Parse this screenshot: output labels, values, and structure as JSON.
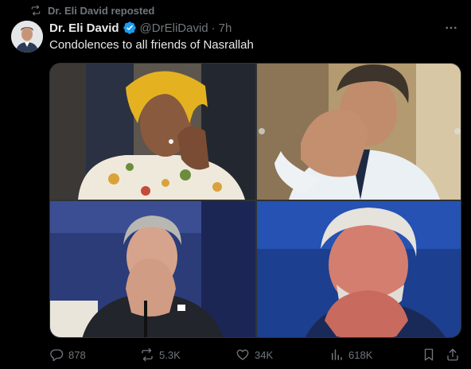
{
  "repost": {
    "label": "Dr. Eli David reposted",
    "icon": "repost-icon"
  },
  "author": {
    "name": "Dr. Eli David",
    "handle": "@DrEliDavid",
    "time_sep": "·",
    "time": "7h",
    "verified_color": "#1d9bf0"
  },
  "tweet": {
    "text": "Condolences to all friends of Nasrallah"
  },
  "media": {
    "count": 4
  },
  "actions": {
    "replies": "878",
    "reposts": "5.3K",
    "likes": "34K",
    "views": "618K"
  },
  "colors": {
    "background": "#000000",
    "muted": "#71767b",
    "text": "#e7e9ea",
    "border": "#2f3336"
  }
}
